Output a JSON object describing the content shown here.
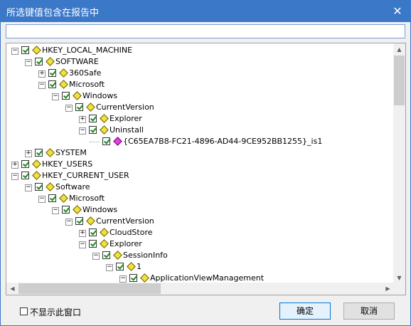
{
  "window": {
    "title": "所选键值包含在报告中",
    "close_glyph": "✕"
  },
  "search": {
    "value": "",
    "placeholder": ""
  },
  "tree": {
    "nodes": [
      {
        "label": "HKEY_LOCAL_MACHINE",
        "expander": "−",
        "icon": "registry-key-icon"
      },
      {
        "label": "SOFTWARE",
        "expander": "−",
        "icon": "registry-key-icon"
      },
      {
        "label": "360Safe",
        "expander": "+",
        "icon": "registry-key-icon"
      },
      {
        "label": "Microsoft",
        "expander": "−",
        "icon": "registry-key-icon"
      },
      {
        "label": "Windows",
        "expander": "−",
        "icon": "registry-key-icon"
      },
      {
        "label": "CurrentVersion",
        "expander": "−",
        "icon": "registry-key-icon"
      },
      {
        "label": "Explorer",
        "expander": "+",
        "icon": "registry-key-icon"
      },
      {
        "label": "Uninstall",
        "expander": "−",
        "icon": "registry-key-icon"
      },
      {
        "label": "{C65EA7B8-FC21-4896-AD44-9CE952BB1255}_is1",
        "expander": "",
        "icon": "registry-key-selected-icon"
      },
      {
        "label": "SYSTEM",
        "expander": "+",
        "icon": "registry-key-icon"
      },
      {
        "label": "HKEY_USERS",
        "expander": "+",
        "icon": "registry-key-icon"
      },
      {
        "label": "HKEY_CURRENT_USER",
        "expander": "−",
        "icon": "registry-key-icon"
      },
      {
        "label": "Software",
        "expander": "−",
        "icon": "registry-key-icon"
      },
      {
        "label": "Microsoft",
        "expander": "−",
        "icon": "registry-key-icon"
      },
      {
        "label": "Windows",
        "expander": "−",
        "icon": "registry-key-icon"
      },
      {
        "label": "CurrentVersion",
        "expander": "−",
        "icon": "registry-key-icon"
      },
      {
        "label": "CloudStore",
        "expander": "+",
        "icon": "registry-key-icon"
      },
      {
        "label": "Explorer",
        "expander": "−",
        "icon": "registry-key-icon"
      },
      {
        "label": "SessionInfo",
        "expander": "−",
        "icon": "registry-key-icon"
      },
      {
        "label": "1",
        "expander": "−",
        "icon": "registry-key-icon"
      },
      {
        "label": "ApplicationViewManagement",
        "expander": "−",
        "icon": "registry-key-icon"
      }
    ]
  },
  "footer": {
    "dont_show_label": "不显示此窗口",
    "ok_label": "确定",
    "cancel_label": "取消"
  },
  "colors": {
    "titlebar": "#3c78c8",
    "key_icon": "#f0e040",
    "selected_key_icon": "#e040e0",
    "check": "#1a8a1a"
  }
}
